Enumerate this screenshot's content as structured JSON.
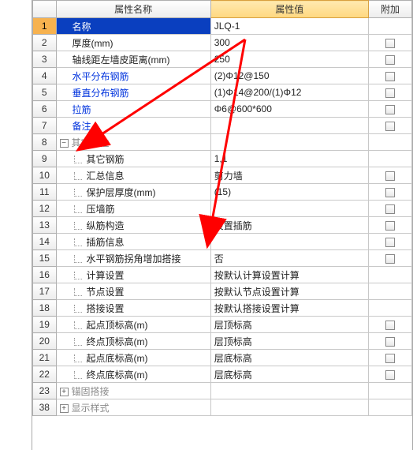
{
  "headers": {
    "num": "",
    "name": "属性名称",
    "value": "属性值",
    "extra": "附加"
  },
  "rows": [
    {
      "n": "1",
      "name": "名称",
      "value": "JLQ-1",
      "chk": false,
      "sel": true,
      "link": false,
      "indent": 1
    },
    {
      "n": "2",
      "name": "厚度(mm)",
      "value": "300",
      "chk": true,
      "link": false,
      "indent": 1
    },
    {
      "n": "3",
      "name": "轴线距左墙皮距离(mm)",
      "value": "250",
      "chk": true,
      "link": false,
      "indent": 1
    },
    {
      "n": "4",
      "name": "水平分布钢筋",
      "value": "(2)Φ12@150",
      "chk": true,
      "link": true,
      "indent": 1
    },
    {
      "n": "5",
      "name": "垂直分布钢筋",
      "value": "(1)Φ14@200/(1)Φ12",
      "chk": true,
      "link": true,
      "indent": 1
    },
    {
      "n": "6",
      "name": "拉筋",
      "value": "Φ6@600*600",
      "chk": true,
      "link": true,
      "indent": 1
    },
    {
      "n": "7",
      "name": "备注",
      "value": "",
      "chk": true,
      "link": true,
      "indent": 1
    },
    {
      "n": "8",
      "name": "其它属性",
      "value": "",
      "chk": false,
      "gray": true,
      "icon": "−",
      "group": true
    },
    {
      "n": "9",
      "name": "其它钢筋",
      "value": "1,1",
      "chk": false,
      "indent": 2
    },
    {
      "n": "10",
      "name": "汇总信息",
      "value": "剪力墙",
      "chk": true,
      "indent": 2
    },
    {
      "n": "11",
      "name": "保护层厚度(mm)",
      "value": "(15)",
      "chk": true,
      "indent": 2
    },
    {
      "n": "12",
      "name": "压墙筋",
      "value": "",
      "chk": true,
      "indent": 2
    },
    {
      "n": "13",
      "name": "纵筋构造",
      "value": "设置插筋",
      "chk": true,
      "indent": 2
    },
    {
      "n": "14",
      "name": "插筋信息",
      "value": "",
      "chk": true,
      "indent": 2
    },
    {
      "n": "15",
      "name": "水平钢筋拐角增加搭接",
      "value": "否",
      "chk": true,
      "indent": 2
    },
    {
      "n": "16",
      "name": "计算设置",
      "value": "按默认计算设置计算",
      "chk": false,
      "indent": 2
    },
    {
      "n": "17",
      "name": "节点设置",
      "value": "按默认节点设置计算",
      "chk": false,
      "indent": 2
    },
    {
      "n": "18",
      "name": "搭接设置",
      "value": "按默认搭接设置计算",
      "chk": false,
      "indent": 2
    },
    {
      "n": "19",
      "name": "起点顶标高(m)",
      "value": "层顶标高",
      "chk": true,
      "indent": 2
    },
    {
      "n": "20",
      "name": "终点顶标高(m)",
      "value": "层顶标高",
      "chk": true,
      "indent": 2
    },
    {
      "n": "21",
      "name": "起点底标高(m)",
      "value": "层底标高",
      "chk": true,
      "indent": 2
    },
    {
      "n": "22",
      "name": "终点底标高(m)",
      "value": "层底标高",
      "chk": true,
      "indent": 2
    },
    {
      "n": "23",
      "name": "锚固搭接",
      "value": "",
      "chk": false,
      "gray": true,
      "icon": "+",
      "group": true
    },
    {
      "n": "38",
      "name": "显示样式",
      "value": "",
      "chk": false,
      "gray": true,
      "icon": "+",
      "group": true
    }
  ]
}
